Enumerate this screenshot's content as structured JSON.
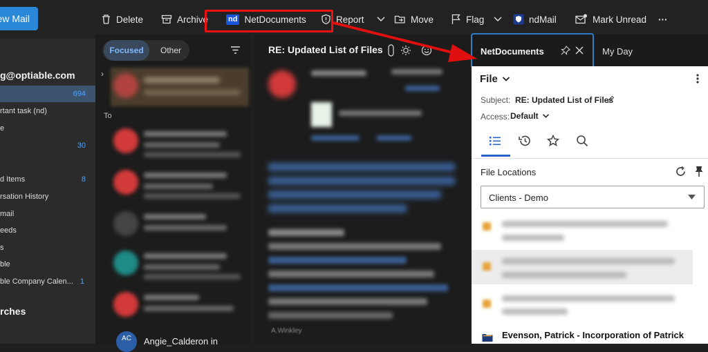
{
  "toolbar": {
    "new_mail": "New Mail",
    "delete": "Delete",
    "archive": "Archive",
    "netdocuments": "NetDocuments",
    "nd_badge": "nd",
    "report": "Report",
    "move": "Move",
    "flag": "Flag",
    "ndmail": "ndMail",
    "mark_unread": "Mark Unread",
    "more": "···"
  },
  "left_nav": {
    "account": "g@optiable.com",
    "items": [
      {
        "label": "",
        "count": "694"
      },
      {
        "label": "rtant task (nd)",
        "count": ""
      },
      {
        "label": "e",
        "count": ""
      },
      {
        "label": "",
        "count": "30"
      },
      {
        "label": "d Items",
        "count": "8"
      },
      {
        "label": "rsation History",
        "count": ""
      },
      {
        "label": "mail",
        "count": ""
      },
      {
        "label": "eeds",
        "count": ""
      },
      {
        "label": "s",
        "count": ""
      },
      {
        "label": "ble",
        "count": ""
      },
      {
        "label": "ble Company Calen...",
        "count": "1"
      }
    ],
    "searches": "rches"
  },
  "message_list": {
    "focused": "Focused",
    "other": "Other",
    "group_label": "To",
    "bottom_sender": "Angie_Calderon in",
    "bottom_initials": "AC"
  },
  "reading_pane": {
    "title": "RE: Updated List of Files",
    "bottom_text": "A.Winkley"
  },
  "right_panel": {
    "tab_active": "NetDocuments",
    "tab_other": "My Day",
    "file_menu": "File",
    "subject_label": "Subject:",
    "subject_value": "RE: Updated List of Files",
    "access_label": "Access:",
    "access_value": "Default",
    "file_locations": "File Locations",
    "select_value": "Clients - Demo",
    "last_item": "Evenson, Patrick - Incorporation of Patrick"
  },
  "colors": {
    "accent": "#2b88d8",
    "highlight_red": "#ee1111",
    "tab_border": "#2d7dc8"
  }
}
